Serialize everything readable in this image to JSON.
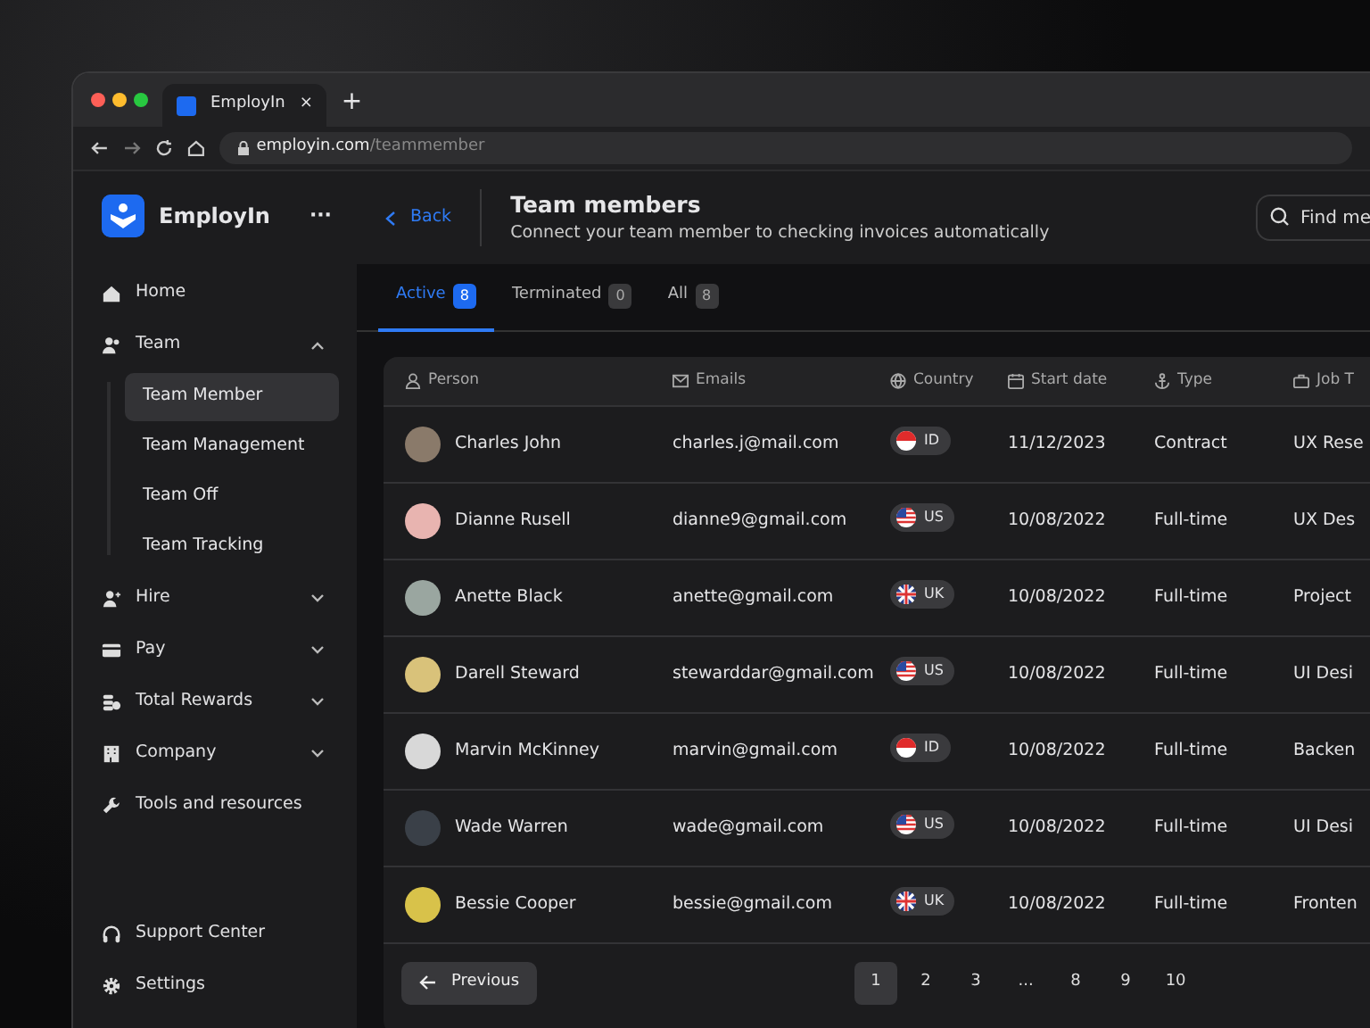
{
  "browser": {
    "tab_title": "EmployIn",
    "close": "×",
    "new_tab": "+",
    "url_host": "employin.com",
    "url_path": "/teammember"
  },
  "sidebar": {
    "brand": "EmployIn",
    "more": "···",
    "items": [
      {
        "label": "Home",
        "kind": "link",
        "selected": false
      },
      {
        "label": "Team",
        "kind": "group",
        "expanded": true,
        "children": [
          {
            "label": "Team Member",
            "selected": true
          },
          {
            "label": "Team Management",
            "selected": false
          },
          {
            "label": "Team Off",
            "selected": false
          },
          {
            "label": "Team Tracking",
            "selected": false
          }
        ]
      },
      {
        "label": "Hire",
        "kind": "group",
        "expanded": false
      },
      {
        "label": "Pay",
        "kind": "group",
        "expanded": false
      },
      {
        "label": "Total Rewards",
        "kind": "group",
        "expanded": false
      },
      {
        "label": "Company",
        "kind": "group",
        "expanded": false
      },
      {
        "label": "Tools and resources",
        "kind": "link",
        "selected": false
      }
    ],
    "footer": [
      {
        "label": "Support Center"
      },
      {
        "label": "Settings"
      }
    ]
  },
  "header": {
    "back": "Back",
    "title": "Team members",
    "subtitle": "Connect your team member to checking invoices automatically",
    "search": {
      "placeholder": "Find me"
    }
  },
  "tabs": [
    {
      "label": "Active",
      "count": "8",
      "selected": true
    },
    {
      "label": "Terminated",
      "count": "0",
      "selected": false
    },
    {
      "label": "All",
      "count": "8",
      "selected": false
    }
  ],
  "table": {
    "columns": [
      "Person",
      "Emails",
      "Country",
      "Start date",
      "Type",
      "Job T"
    ],
    "rows": [
      {
        "person": "Charles John",
        "email": "charles.j@mail.com",
        "country": "ID",
        "start_date": "11/12/2023",
        "type": "Contract",
        "job": "UX Rese"
      },
      {
        "person": "Dianne Rusell",
        "email": "dianne9@gmail.com",
        "country": "US",
        "start_date": "10/08/2022",
        "type": "Full-time",
        "job": "UX Des"
      },
      {
        "person": "Anette Black",
        "email": "anette@gmail.com",
        "country": "UK",
        "start_date": "10/08/2022",
        "type": "Full-time",
        "job": "Project"
      },
      {
        "person": "Darell Steward",
        "email": "stewarddar@gmail.com",
        "country": "US",
        "start_date": "10/08/2022",
        "type": "Full-time",
        "job": "UI Desi"
      },
      {
        "person": "Marvin McKinney",
        "email": "marvin@gmail.com",
        "country": "ID",
        "start_date": "10/08/2022",
        "type": "Full-time",
        "job": "Backen"
      },
      {
        "person": "Wade Warren",
        "email": "wade@gmail.com",
        "country": "US",
        "start_date": "10/08/2022",
        "type": "Full-time",
        "job": "UI Desi"
      },
      {
        "person": "Bessie Cooper",
        "email": "bessie@gmail.com",
        "country": "UK",
        "start_date": "10/08/2022",
        "type": "Full-time",
        "job": "Fronten"
      }
    ]
  },
  "pagination": {
    "previous": "Previous",
    "pages": [
      {
        "label": "1",
        "selected": true
      },
      {
        "label": "2",
        "selected": false
      },
      {
        "label": "3",
        "selected": false
      },
      {
        "label": "...",
        "selected": false
      },
      {
        "label": "8",
        "selected": false
      },
      {
        "label": "9",
        "selected": false
      },
      {
        "label": "10",
        "selected": false
      }
    ]
  }
}
